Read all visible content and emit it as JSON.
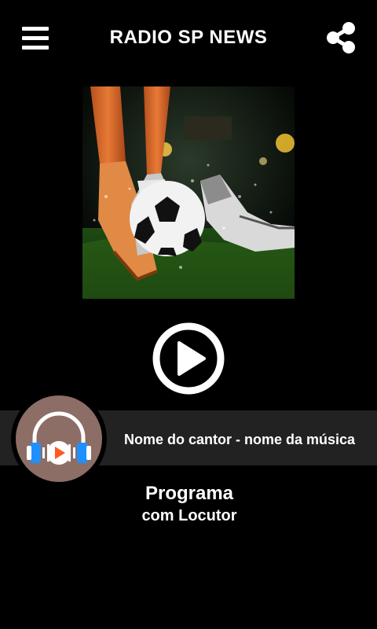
{
  "header": {
    "title": "RADIO SP NEWS",
    "menu_icon": "hamburger-menu-icon",
    "share_icon": "share-icon"
  },
  "cover": {
    "alt": "soccer ball and cleats on wet grass in stadium"
  },
  "player": {
    "play_icon": "play-icon",
    "track": "Nome do cantor - nome da música",
    "logo_icon": "headphones-play-logo"
  },
  "program": {
    "title": "Programa",
    "host": "com Locutor"
  },
  "colors": {
    "background": "#000000",
    "bar": "#222222",
    "logo_bg": "#8c6e66",
    "headphone_blue": "#1e90ff",
    "play_orange": "#ff5a1f"
  }
}
